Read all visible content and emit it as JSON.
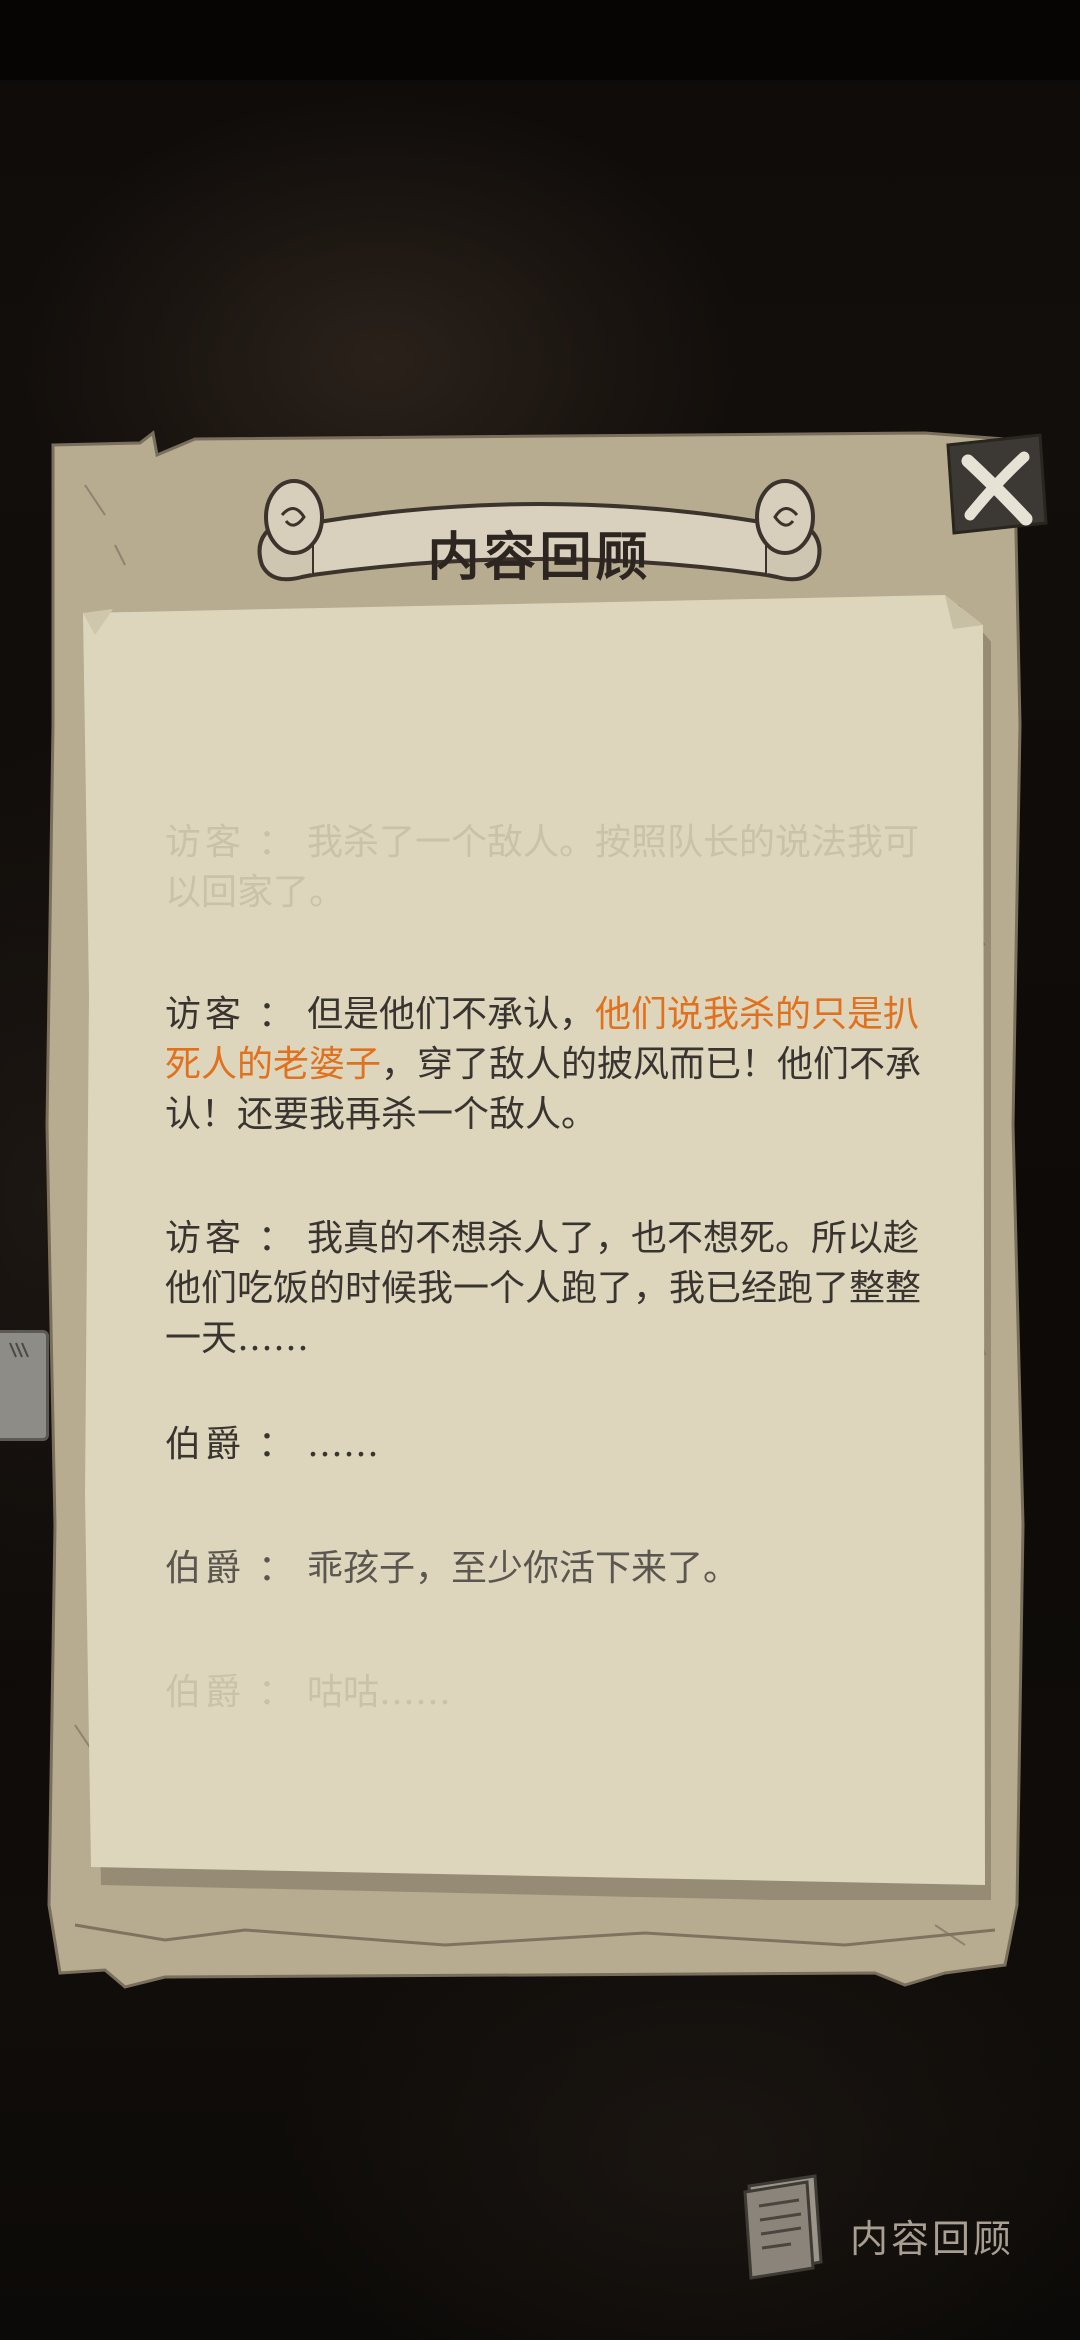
{
  "panel": {
    "title": "内容回顾",
    "close_icon": "close-x-icon"
  },
  "dialogue": [
    {
      "speaker": "访客",
      "separator": "：",
      "segments": [
        {
          "text": "我杀了一个敌人。按照队长的说法我可以回家了。",
          "highlight": false
        }
      ],
      "faded": true
    },
    {
      "speaker": "访客",
      "separator": "：",
      "segments": [
        {
          "text": "但是他们不承认，",
          "highlight": false
        },
        {
          "text": "他们说我杀的只是扒死人的老婆子",
          "highlight": true
        },
        {
          "text": "，穿了敌人的披风而已！他们不承认！还要我再杀一个敌人。",
          "highlight": false
        }
      ],
      "faded": false
    },
    {
      "speaker": "访客",
      "separator": "：",
      "segments": [
        {
          "text": "我真的不想杀人了，也不想死。所以趁他们吃饭的时候我一个人跑了，我已经跑了整整一天……",
          "highlight": false
        }
      ],
      "faded": false
    },
    {
      "speaker": "伯爵",
      "separator": "：",
      "segments": [
        {
          "text": "……",
          "highlight": false
        }
      ],
      "faded": false
    },
    {
      "speaker": "伯爵",
      "separator": "：",
      "segments": [
        {
          "text": "乖孩子，至少你活下来了。",
          "highlight": false
        }
      ],
      "faded": false
    },
    {
      "speaker": "伯爵",
      "separator": "：",
      "segments": [
        {
          "text": "咕咕……",
          "highlight": false
        }
      ],
      "faded": true
    }
  ],
  "footer": {
    "label": "内容回顾",
    "icon": "document-icon"
  },
  "colors": {
    "highlight": "#e0711f",
    "text": "#3a3430",
    "parchment": "#ddd6bc"
  }
}
